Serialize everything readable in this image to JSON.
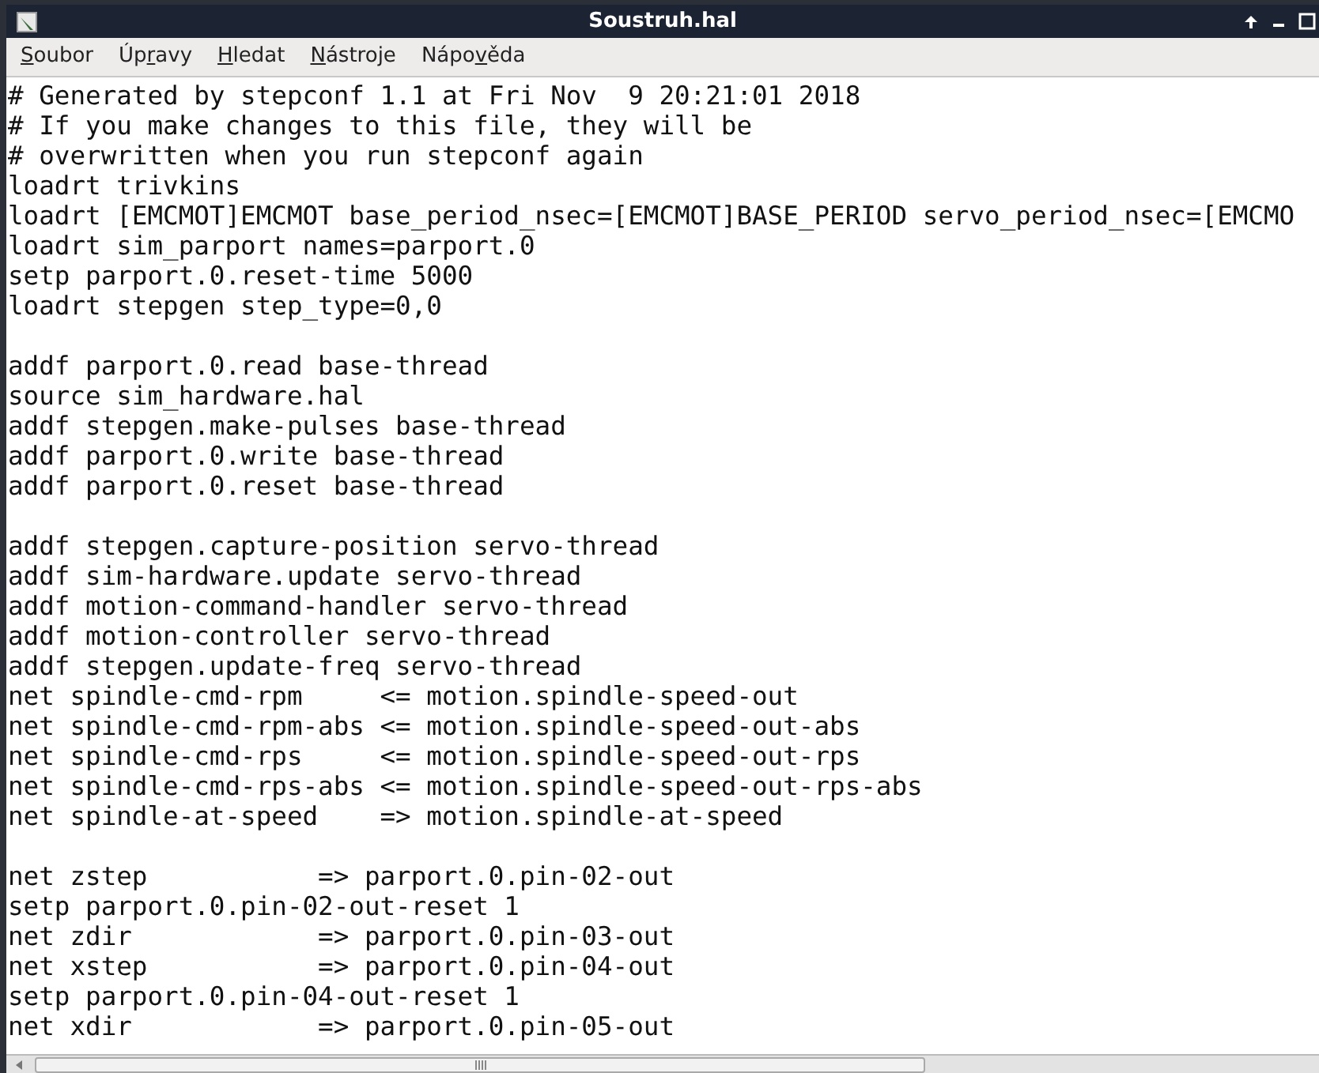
{
  "window": {
    "title": "Soustruh.hal"
  },
  "menu": [
    {
      "key": "S",
      "after": "oubor"
    },
    {
      "before": "Úp",
      "key": "r",
      "after": "avy"
    },
    {
      "key": "H",
      "after": "ledat"
    },
    {
      "key": "N",
      "after": "ástroje"
    },
    {
      "before": "Nápo",
      "key": "v",
      "after": "ěda"
    }
  ],
  "editor": {
    "blocks": [
      [
        "# Generated by stepconf 1.1 at Fri Nov  9 20:21:01 2018",
        "# If you make changes to this file, they will be",
        "# overwritten when you run stepconf again",
        "loadrt trivkins",
        "loadrt [EMCMOT]EMCMOT base_period_nsec=[EMCMOT]BASE_PERIOD servo_period_nsec=[EMCMO",
        "loadrt sim_parport names=parport.0",
        "setp parport.0.reset-time 5000",
        "loadrt stepgen step_type=0,0"
      ],
      [
        "addf parport.0.read base-thread",
        "source sim_hardware.hal",
        "addf stepgen.make-pulses base-thread",
        "addf parport.0.write base-thread",
        "addf parport.0.reset base-thread"
      ],
      [
        "addf stepgen.capture-position servo-thread",
        "addf sim-hardware.update servo-thread",
        "addf motion-command-handler servo-thread",
        "addf motion-controller servo-thread",
        "addf stepgen.update-freq servo-thread",
        "net spindle-cmd-rpm     <= motion.spindle-speed-out",
        "net spindle-cmd-rpm-abs <= motion.spindle-speed-out-abs",
        "net spindle-cmd-rps     <= motion.spindle-speed-out-rps",
        "net spindle-cmd-rps-abs <= motion.spindle-speed-out-rps-abs",
        "net spindle-at-speed    => motion.spindle-at-speed"
      ],
      [
        "net zstep           => parport.0.pin-02-out",
        "setp parport.0.pin-02-out-reset 1",
        "net zdir            => parport.0.pin-03-out",
        "net xstep           => parport.0.pin-04-out",
        "setp parport.0.pin-04-out-reset 1",
        "net xdir            => parport.0.pin-05-out"
      ]
    ]
  }
}
